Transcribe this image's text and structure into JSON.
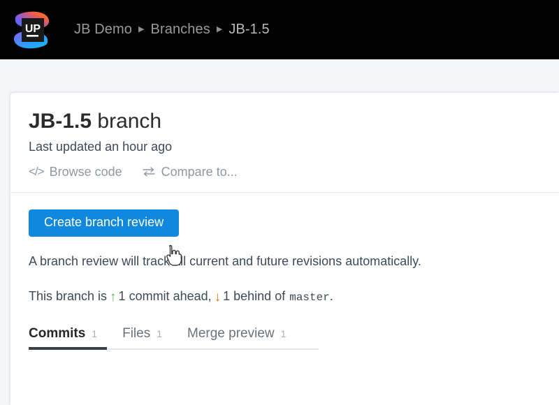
{
  "header": {
    "logo_alt": "Upsource logo",
    "logo_text": "UP",
    "breadcrumb": [
      {
        "label": "JB Demo"
      },
      {
        "label": "Branches"
      },
      {
        "label": "JB-1.5"
      }
    ],
    "separator": "▶"
  },
  "branch": {
    "name": "JB-1.5",
    "title_suffix": "branch",
    "last_updated": "Last updated an hour ago",
    "actions": [
      {
        "label": "Browse code",
        "icon": "code-icon",
        "glyph": "</>"
      },
      {
        "label": "Compare to...",
        "icon": "compare-icon",
        "glyph": "⇄"
      }
    ]
  },
  "body": {
    "create_review_label": "Create branch review",
    "description": "A branch review will track all current and future revisions automatically.",
    "status": {
      "prefix": "This branch is",
      "ahead_arrow": "↑",
      "ahead_count": "1",
      "ahead_text": "commit ahead,",
      "behind_arrow": "↓",
      "behind_count": "1",
      "behind_text": "behind of",
      "base_branch": "master",
      "suffix": "."
    }
  },
  "tabs": [
    {
      "label": "Commits",
      "count": "1",
      "active": true
    },
    {
      "label": "Files",
      "count": "1",
      "active": false
    },
    {
      "label": "Merge preview",
      "count": "1",
      "active": false
    }
  ],
  "colors": {
    "accent_blue": "#1188e0",
    "ahead_green": "#5cb85c",
    "behind_orange": "#e8710a",
    "header_black": "#000000",
    "page_bg": "#f4f6f8"
  }
}
